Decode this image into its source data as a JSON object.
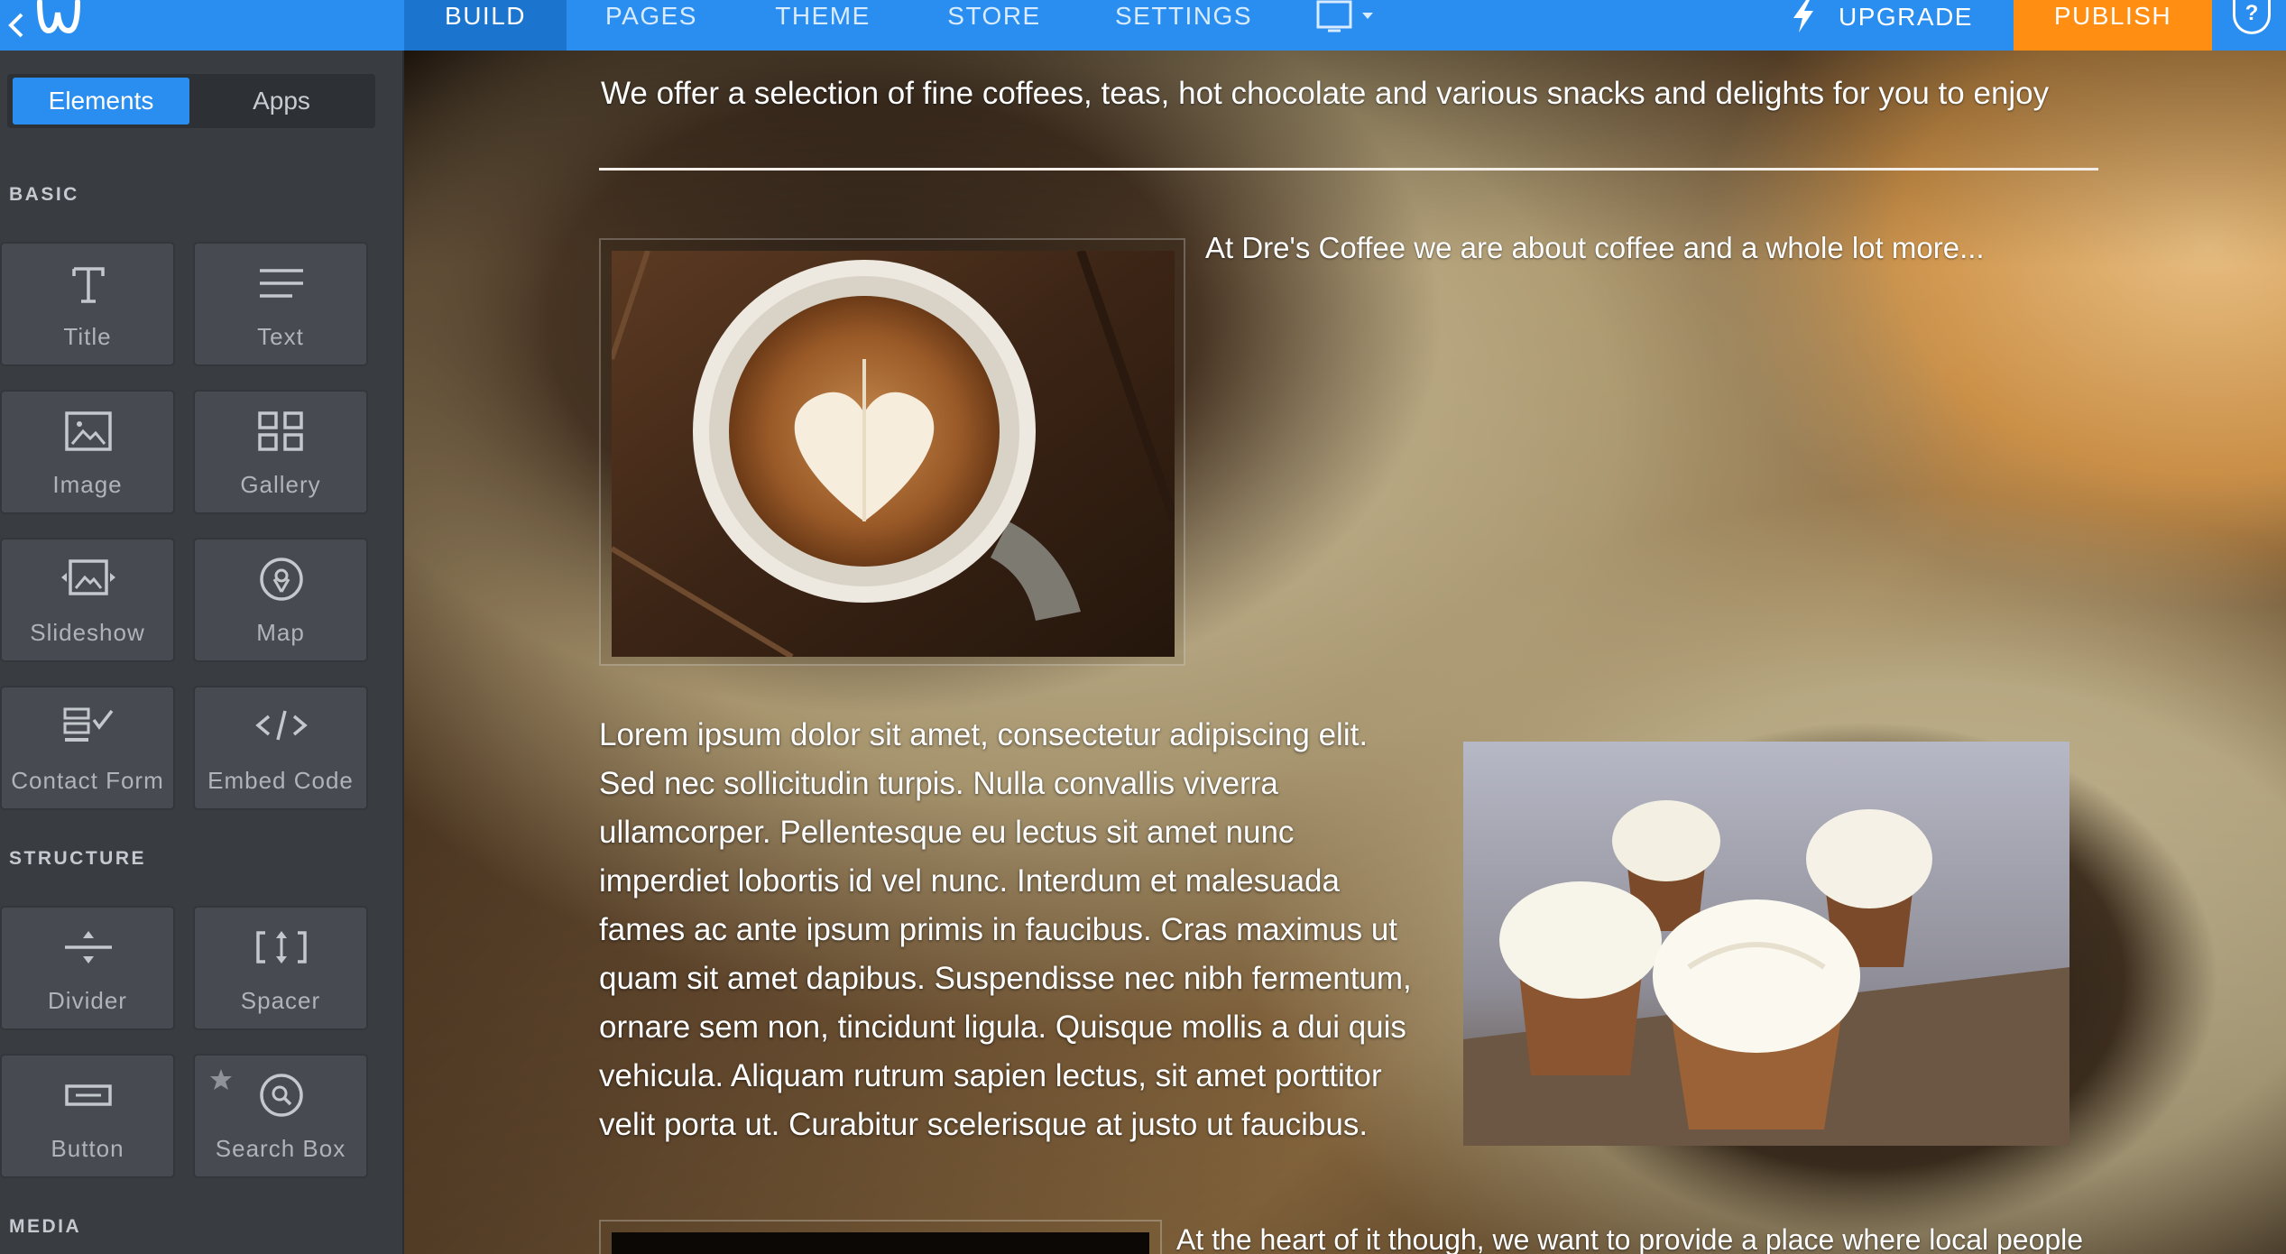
{
  "topbar": {
    "tabs": [
      {
        "label": "BUILD"
      },
      {
        "label": "PAGES"
      },
      {
        "label": "THEME"
      },
      {
        "label": "STORE"
      },
      {
        "label": "SETTINGS"
      }
    ],
    "upgrade_label": "UPGRADE",
    "publish_label": "PUBLISH",
    "help_label": "?",
    "colors": {
      "bar": "#2a8ef0",
      "active_tab": "#1b74cd",
      "publish": "#ff8e12"
    }
  },
  "sidebar": {
    "segments": {
      "elements": "Elements",
      "apps": "Apps"
    },
    "sections": {
      "basic": "BASIC",
      "structure": "STRUCTURE",
      "media": "MEDIA"
    },
    "basic_items": [
      {
        "label": "Title",
        "icon": "title-icon"
      },
      {
        "label": "Text",
        "icon": "text-icon"
      },
      {
        "label": "Image",
        "icon": "image-icon"
      },
      {
        "label": "Gallery",
        "icon": "gallery-icon"
      },
      {
        "label": "Slideshow",
        "icon": "slideshow-icon"
      },
      {
        "label": "Map",
        "icon": "map-pin-icon"
      },
      {
        "label": "Contact Form",
        "icon": "contact-form-icon"
      },
      {
        "label": "Embed Code",
        "icon": "embed-code-icon"
      }
    ],
    "structure_items": [
      {
        "label": "Divider",
        "icon": "divider-icon"
      },
      {
        "label": "Spacer",
        "icon": "spacer-icon"
      },
      {
        "label": "Button",
        "icon": "button-icon"
      },
      {
        "label": "Search Box",
        "icon": "search-icon"
      }
    ]
  },
  "content": {
    "tagline": "We offer a selection of fine coffees, teas, hot chocolate and various snacks and delights for you to enjoy",
    "intro": "At Dre's Coffee we are about coffee and a whole lot more...",
    "lorem_lines": [
      "Lorem ipsum dolor sit amet, consectetur adipiscing elit.",
      "Sed nec sollicitudin turpis. Nulla convallis viverra",
      "ullamcorper. Pellentesque eu lectus sit amet nunc",
      "imperdiet lobortis id vel nunc. Interdum et malesuada",
      "fames ac ante ipsum primis in faucibus. Cras maximus ut",
      "quam sit amet dapibus. Suspendisse nec nibh fermentum,",
      "ornare sem non, tincidunt ligula. Quisque mollis a dui quis",
      "vehicula. Aliquam rutrum sapien lectus, sit amet porttitor",
      "velit porta ut. Curabitur scelerisque at justo ut faucibus."
    ],
    "bottom_text": "At the heart of it though, we want to provide a place where local people"
  }
}
